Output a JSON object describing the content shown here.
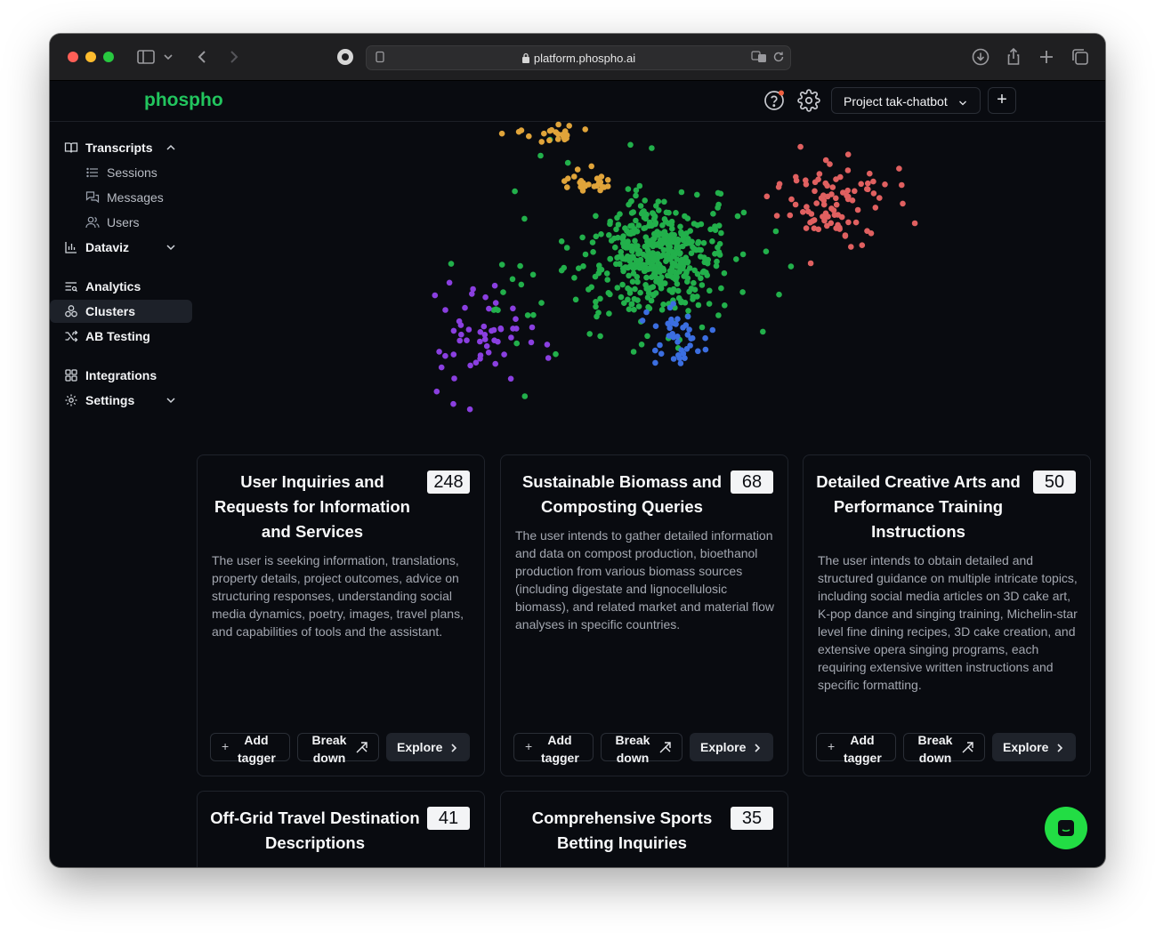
{
  "browser": {
    "url": "platform.phospho.ai"
  },
  "app": {
    "logo": "phospho",
    "project_label": "Project tak-chatbot"
  },
  "sidebar": {
    "transcripts": "Transcripts",
    "sessions": "Sessions",
    "messages": "Messages",
    "users": "Users",
    "dataviz": "Dataviz",
    "analytics": "Analytics",
    "clusters": "Clusters",
    "ab_testing": "AB Testing",
    "integrations": "Integrations",
    "settings": "Settings"
  },
  "clusters_colors": {
    "orange": "#e0a43a",
    "green": "#22b04b",
    "red": "#e06060",
    "purple": "#8a3fe0",
    "blue": "#3b6ee0"
  },
  "cards": [
    {
      "title": "User Inquiries and Requests for Information and Services",
      "count": "248",
      "description": "The user is seeking information, translations, property details, project outcomes, advice on structuring responses, understanding social media dynamics, poetry, images, travel plans, and capabilities of tools and the assistant.",
      "add_tagger": "Add tagger",
      "break_down": "Break down",
      "explore": "Explore"
    },
    {
      "title": "Sustainable Biomass and Composting Queries",
      "count": "68",
      "description": "The user intends to gather detailed information and data on compost production, bioethanol production from various biomass sources (including digestate and lignocellulosic biomass), and related market and material flow analyses in specific countries.",
      "add_tagger": "Add tagger",
      "break_down": "Break down",
      "explore": "Explore"
    },
    {
      "title": "Detailed Creative Arts and Performance Training Instructions",
      "count": "50",
      "description": "The user intends to obtain detailed and structured guidance on multiple intricate topics, including social media articles on 3D cake art, K-pop dance and singing training, Michelin-star level fine dining recipes, 3D cake creation, and extensive opera singing programs, each requiring extensive written instructions and specific formatting.",
      "add_tagger": "Add tagger",
      "break_down": "Break down",
      "explore": "Explore"
    },
    {
      "title": "Off-Grid Travel Destination Descriptions",
      "count": "41"
    },
    {
      "title": "Comprehensive Sports Betting Inquiries",
      "count": "35"
    }
  ]
}
